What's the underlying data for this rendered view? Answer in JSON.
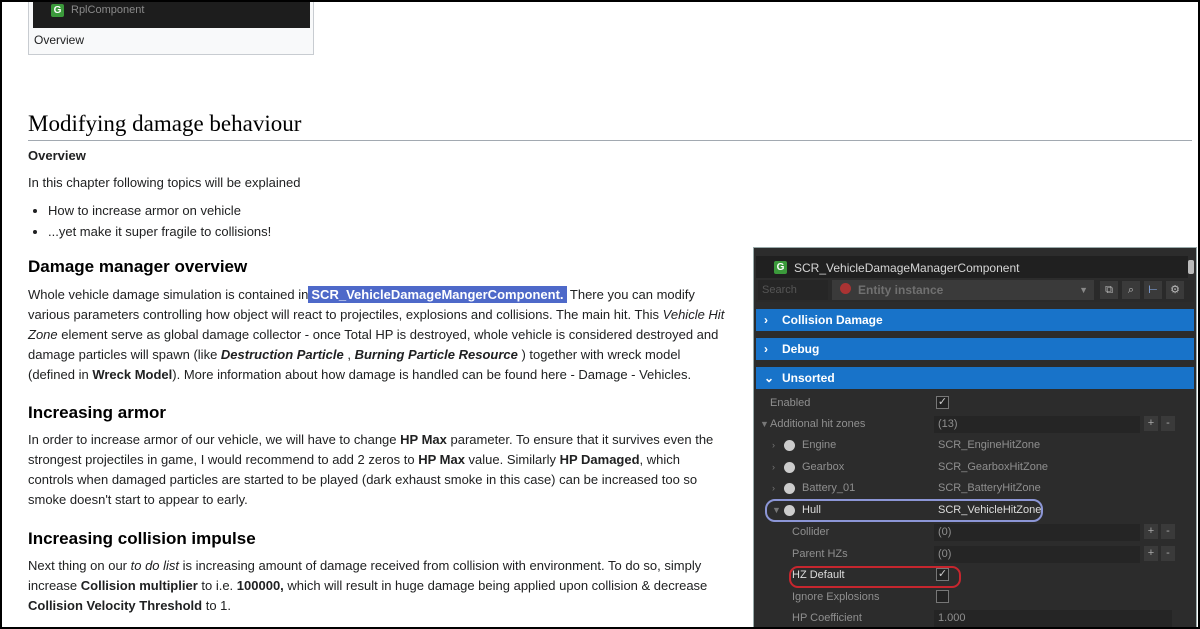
{
  "thumbnail": {
    "image_label": "RplComponent",
    "image_icon": "G",
    "caption": "Overview"
  },
  "page": {
    "title": "Modifying damage behaviour",
    "overview_label": "Overview",
    "intro": "In this chapter following topics will be explained",
    "bullets": [
      "How to increase armor on vehicle",
      "...yet make it super fragile to collisions!"
    ]
  },
  "sections": {
    "damage_manager": {
      "heading": "Damage manager overview",
      "t1": "Whole vehicle damage simulation is contained in",
      "highlight": "SCR_VehicleDamageMangerComponent.",
      "t2": " There you can modify various parameters controlling how object will react to projectiles, explosions and collisions. The main hit. This ",
      "t3": "Vehicle Hit Zone",
      "t4": " element serve as global damage collector - once Total HP is destroyed, whole vehicle is considered destroyed and damage particles will spawn (like ",
      "t5": "Destruction Particle",
      "t6": " , ",
      "t7": "Burning Particle Resource",
      "t8": " ) together with wreck model (defined in ",
      "t9": "Wreck Model",
      "t10": "). More information about how damage is handled can be found here - Damage - Vehicles."
    },
    "armor": {
      "heading": "Increasing armor",
      "t1": "In order to increase armor of our vehicle, we will have to change ",
      "t2": "HP Max",
      "t3": " parameter. To ensure that it survives even the strongest projectiles in game, I would recommend to add 2 zeros to ",
      "t4": "HP Max",
      "t5": " value. Similarly ",
      "t6": "HP Damaged",
      "t7": ", which controls when damaged particles are started to be played (dark exhaust smoke in this case) can be increased too so smoke doesn't start to appear to early."
    },
    "collision": {
      "heading": "Increasing collision impulse",
      "t1": "Next thing on our ",
      "t2": "to do list",
      "t3": " is increasing amount of damage received from collision with environment. To do so, simply increase ",
      "t4": "Collision multiplier",
      "t5": " to i.e. ",
      "t6": "100000,",
      "t7": " which will result in huge damage being applied upon collision & decrease ",
      "t8": "Collision Velocity Threshold",
      "t9": " to 1."
    }
  },
  "editor": {
    "title": "SCR_VehicleDamageManagerComponent",
    "title_icon": "G",
    "search_placeholder": "Search",
    "entity_label": "Entity instance",
    "sections": [
      "Collision Damage",
      "Debug",
      "Unsorted"
    ],
    "rows": {
      "enabled": {
        "key": "Enabled",
        "checked": true
      },
      "additional": {
        "key": "Additional hit zones",
        "value": "(13)"
      },
      "engine": {
        "key": "Engine",
        "value": "SCR_EngineHitZone"
      },
      "gearbox": {
        "key": "Gearbox",
        "value": "SCR_GearboxHitZone"
      },
      "battery": {
        "key": "Battery_01",
        "value": "SCR_BatteryHitZone"
      },
      "hull": {
        "key": "Hull",
        "value": "SCR_VehicleHitZone"
      },
      "collider": {
        "key": "Collider",
        "value": "(0)"
      },
      "parent": {
        "key": "Parent HZs",
        "value": "(0)"
      },
      "hzdefault": {
        "key": "HZ Default",
        "checked": true
      },
      "ignore": {
        "key": "Ignore Explosions",
        "checked": false
      },
      "hpcoef": {
        "key": "HP Coefficient",
        "value": "1.000"
      }
    },
    "check_glyph": "✓",
    "plus_glyph": "+",
    "minus_glyph": "-"
  }
}
